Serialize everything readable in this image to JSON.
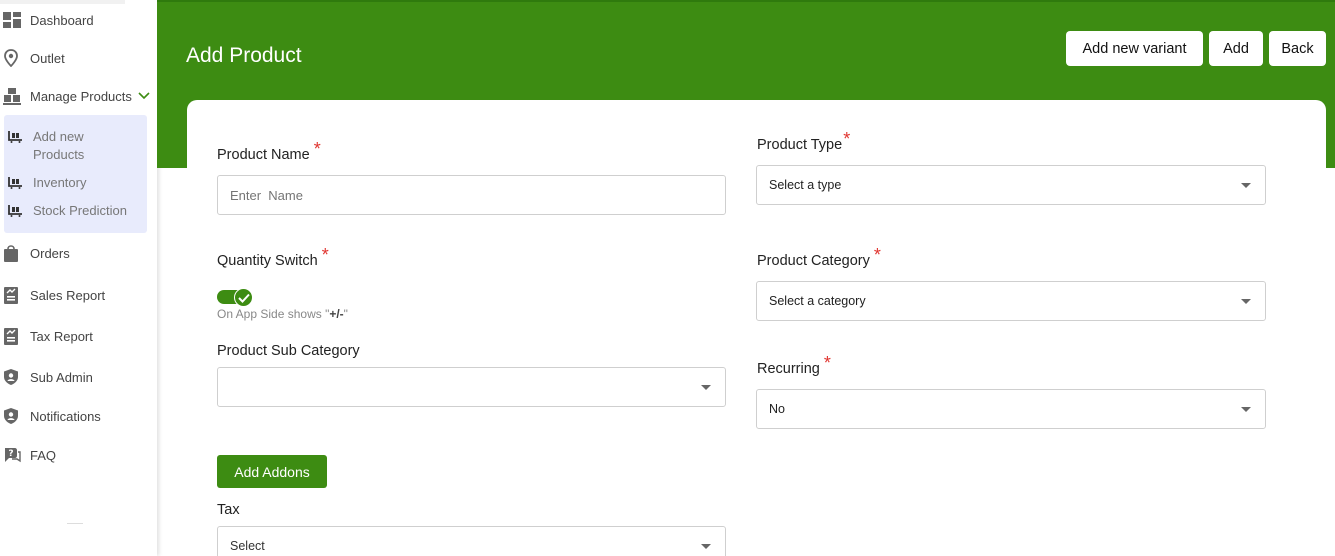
{
  "sidebar": {
    "items": [
      {
        "label": "Dashboard",
        "icon": "dashboard-icon"
      },
      {
        "label": "Outlet",
        "icon": "location-pin-icon"
      },
      {
        "label": "Manage Products",
        "icon": "boxes-icon"
      },
      {
        "label": "Orders",
        "icon": "shopping-bag-icon"
      },
      {
        "label": "Sales Report",
        "icon": "report-icon"
      },
      {
        "label": "Tax Report",
        "icon": "report-icon"
      },
      {
        "label": "Sub Admin",
        "icon": "shield-user-icon"
      },
      {
        "label": "Notifications",
        "icon": "shield-user-icon"
      },
      {
        "label": "FAQ",
        "icon": "faq-icon"
      }
    ],
    "submenu": [
      {
        "label": "Add new Products",
        "icon": "trolley-icon"
      },
      {
        "label": "Inventory",
        "icon": "trolley-icon"
      },
      {
        "label": "Stock Prediction",
        "icon": "trolley-icon"
      }
    ]
  },
  "header": {
    "title": "Add Product",
    "buttons": {
      "add_variant": "Add new variant",
      "add": "Add",
      "back": "Back"
    }
  },
  "form": {
    "product_name": {
      "label": "Product Name",
      "placeholder": "Enter  Name"
    },
    "product_type": {
      "label": "Product Type",
      "value": "Select a type"
    },
    "quantity_switch": {
      "label": "Quantity Switch",
      "hint_prefix": "On App Side shows \"",
      "hint_symbol": "+/-",
      "hint_suffix": "\"",
      "enabled": true
    },
    "product_category": {
      "label": "Product Category",
      "value": "Select a category"
    },
    "product_sub_category": {
      "label": "Product Sub Category",
      "value": ""
    },
    "recurring": {
      "label": "Recurring",
      "value": "No"
    },
    "add_addons": "Add Addons",
    "tax": {
      "label": "Tax",
      "value": "Select"
    },
    "required_mark": "*"
  },
  "colors": {
    "brand_green": "#3d8c12",
    "required": "#e0342f",
    "submenu_bg": "#e8ebfc"
  }
}
